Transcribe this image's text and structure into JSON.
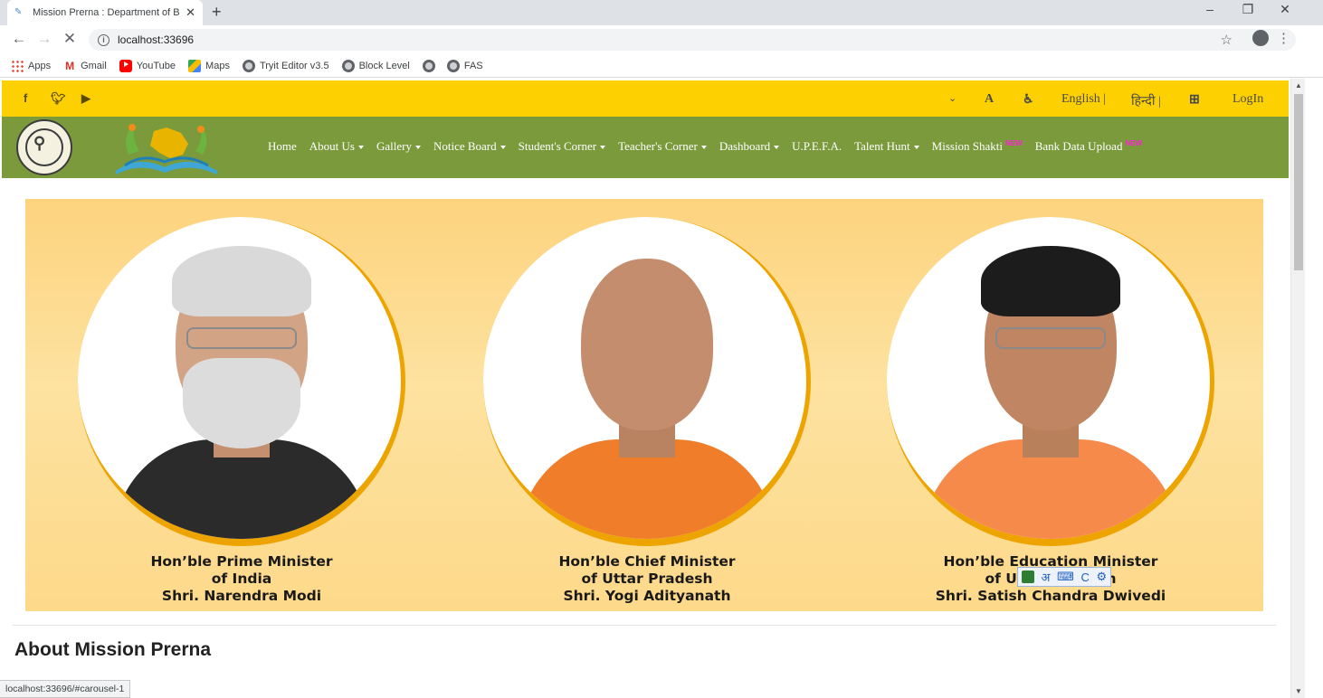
{
  "browser": {
    "tab_title": "Mission Prerna : Department of B",
    "url": "localhost:33696",
    "status_url": "localhost:33696/#carousel-1",
    "bookmarks": [
      "Apps",
      "Gmail",
      "YouTube",
      "Maps",
      "Tryit Editor v3.5",
      "Block Level",
      "",
      "FAS"
    ]
  },
  "topbar": {
    "font_size_label": "A",
    "language_english": "English |",
    "language_hindi": "हिन्दी |",
    "login": "LogIn"
  },
  "nav": {
    "items": [
      "Home",
      "About Us",
      "Gallery",
      "Notice Board",
      "Student's Corner",
      "Teacher's Corner",
      "Dashboard",
      "U.P.E.F.A.",
      "Talent Hunt",
      "Mission Shakti",
      "Bank Data Upload"
    ],
    "new_badge": "NEW"
  },
  "banner": {
    "captions": [
      {
        "line1": "Hon’ble Prime Minister",
        "line2": "of India",
        "line3": "Shri. Narendra Modi"
      },
      {
        "line1": "Hon’ble Chief Minister",
        "line2": "of Uttar Pradesh",
        "line3": "Shri. Yogi Adityanath"
      },
      {
        "line1": "Hon’ble Education Minister",
        "line2": "of Uttar Pradesh",
        "line3": "Shri. Satish Chandra Dwivedi"
      }
    ]
  },
  "widget": {
    "hindi_char": "अ",
    "c_letter": "C"
  },
  "section": {
    "heading": "About Mission Prerna"
  },
  "colors": {
    "topbar": "#fdd002",
    "navbar": "#7a9a3c",
    "banner": "#fdd37e",
    "ring": "#eda400"
  }
}
